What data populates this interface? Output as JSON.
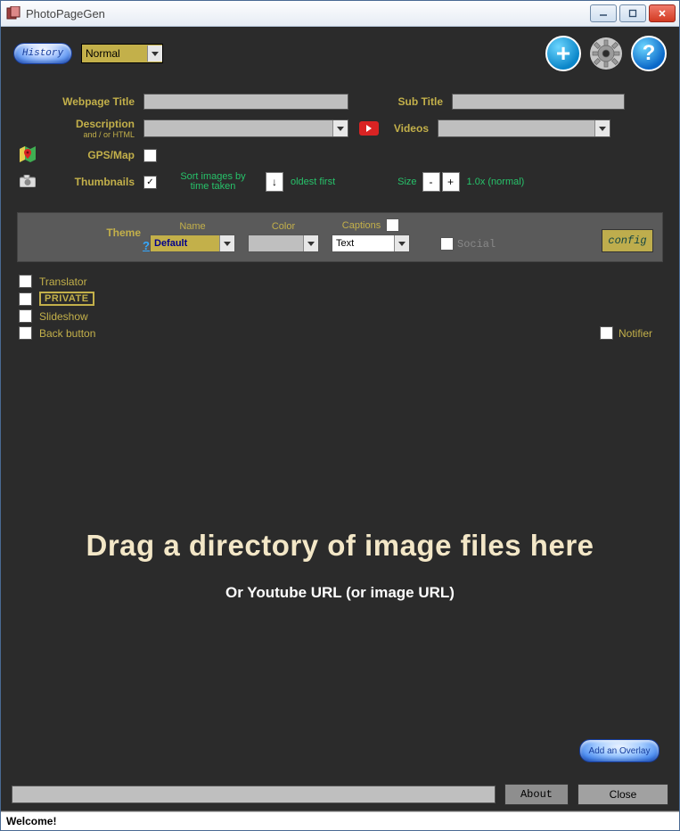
{
  "window": {
    "title": "PhotoPageGen"
  },
  "topbar": {
    "history_label": "History",
    "mode_value": "Normal"
  },
  "form": {
    "title_label": "Webpage Title",
    "title_value": "",
    "subtitle_label": "Sub Title",
    "subtitle_value": "",
    "desc_label": "Description",
    "desc_sub": "and / or HTML",
    "desc_value": "",
    "videos_label": "Videos",
    "videos_value": "",
    "gps_label": "GPS/Map",
    "gps_checked": false,
    "thumbs_label": "Thumbnails",
    "thumbs_checked": true,
    "sort_text": "Sort images by time taken",
    "sort_btn": "↓",
    "sort_order": "oldest first",
    "size_label": "Size",
    "size_minus": "-",
    "size_plus": "+",
    "size_value": "1.0x (normal)"
  },
  "theme": {
    "label": "Theme",
    "help": "?",
    "name_head": "Name",
    "name_value": "Default",
    "color_head": "Color",
    "color_value": "",
    "captions_head": "Captions",
    "captions_checked": false,
    "captions_value": "Text",
    "social_label": "Social",
    "social_checked": false,
    "config_label": "config"
  },
  "options": {
    "translator": {
      "label": "Translator",
      "checked": false
    },
    "private": {
      "label": "PRIVATE",
      "checked": false
    },
    "slideshow": {
      "label": "Slideshow",
      "checked": false
    },
    "backbutton": {
      "label": "Back button",
      "checked": false
    },
    "notifier": {
      "label": "Notifier",
      "checked": false
    }
  },
  "drop": {
    "main": "Drag a directory of image files here",
    "sub": "Or Youtube URL (or image URL)"
  },
  "overlay_label": "Add an Overlay",
  "bottom": {
    "about_label": "About",
    "close_label": "Close"
  },
  "status": "Welcome!"
}
